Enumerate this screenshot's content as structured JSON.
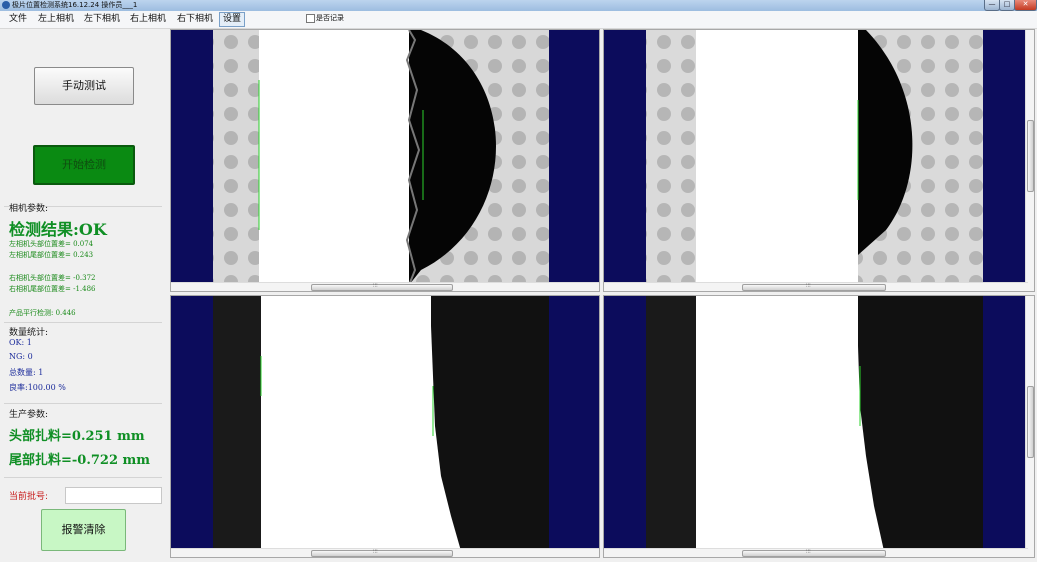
{
  "window": {
    "title": "极片位置检测系统16.12.24   操作员___1",
    "controls": {
      "minimize": "—",
      "maximize": "□",
      "close": "✕"
    }
  },
  "menu": {
    "items": [
      "文件",
      "左上相机",
      "左下相机",
      "右上相机",
      "右下相机",
      "设置"
    ],
    "selected": "设置",
    "record_checkbox": {
      "label": "是否记录",
      "checked": false
    }
  },
  "buttons": {
    "manual_test": "手动测试",
    "start_detect": "开始检测",
    "alarm_clear": "报警清除"
  },
  "camera_params": {
    "title": "相机参数:",
    "result": "检测结果:OK",
    "left_head": "左相机头部位置差= 0.074",
    "left_tail": "左相机尾部位置差= 0.243",
    "right_head": "右相机头部位置差= -0.372",
    "right_tail": "右相机尾部位置差= -1.486",
    "parallel": "产品平行检测: 0.446"
  },
  "stats": {
    "title": "数量统计:",
    "ok": "OK:  1",
    "ng": "NG:  0",
    "total": "总数量:  1",
    "yield": "良率:100.00 %"
  },
  "production": {
    "title": "生产参数:",
    "head": "头部扎料=0.251 mm",
    "tail": "尾部扎料=-0.722 mm"
  },
  "batch": {
    "label": "当前批号:",
    "value": ""
  },
  "scroll_glyph": "⁝⁝⁝",
  "colors": {
    "navy": "#0c0c5c",
    "accent_green": "#0f8f24",
    "start_button": "#0a8a12",
    "alarm_button": "#c8f7c5",
    "batch_label": "#c82020",
    "stats_text": "#1a2a9a"
  },
  "cameras": [
    {
      "name": "top-left",
      "icon": "camera-view-top-left"
    },
    {
      "name": "top-right",
      "icon": "camera-view-top-right"
    },
    {
      "name": "bottom-left",
      "icon": "camera-view-bottom-left"
    },
    {
      "name": "bottom-right",
      "icon": "camera-view-bottom-right"
    }
  ]
}
